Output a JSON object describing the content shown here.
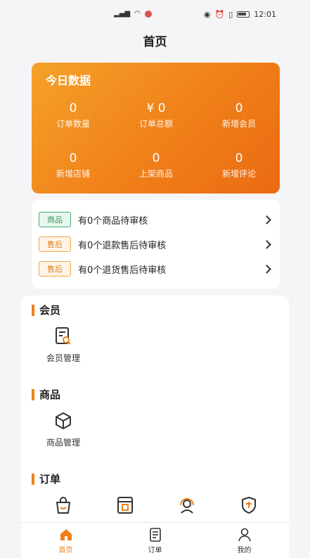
{
  "status_bar": {
    "time": "12:01"
  },
  "header": {
    "title": "首页"
  },
  "today": {
    "title": "今日数据",
    "stats": [
      {
        "value": "0",
        "label": "订单数量"
      },
      {
        "value": "¥ 0",
        "label": "订单总额"
      },
      {
        "value": "0",
        "label": "新增会员"
      },
      {
        "value": "0",
        "label": "新增店铺"
      },
      {
        "value": "0",
        "label": "上架商品"
      },
      {
        "value": "0",
        "label": "新增评论"
      }
    ]
  },
  "pending": [
    {
      "tag": "商品",
      "text": "有0个商品待审核",
      "tag_color": "#3eb06f"
    },
    {
      "tag": "售后",
      "text": "有0个退款售后待审核",
      "tag_color": "#f0a64e"
    },
    {
      "tag": "售后",
      "text": "有0个退货售后待审核",
      "tag_color": "#f0a64e"
    }
  ],
  "sections": {
    "member": {
      "title": "会员",
      "items": [
        {
          "label": "会员管理",
          "icon": "member-doc-search-icon"
        }
      ]
    },
    "goods": {
      "title": "商品",
      "items": [
        {
          "label": "商品管理",
          "icon": "cube-box-icon"
        }
      ]
    },
    "order": {
      "title": "订单",
      "items": [
        {
          "icon": "shopping-bag-icon"
        },
        {
          "icon": "order-box-icon"
        },
        {
          "icon": "customer-service-icon"
        },
        {
          "icon": "after-sale-shield-icon"
        }
      ]
    }
  },
  "tabbar": [
    {
      "label": "首页",
      "icon": "home-icon",
      "active": true
    },
    {
      "label": "订单",
      "icon": "order-doc-icon",
      "active": false
    },
    {
      "label": "我的",
      "icon": "user-icon",
      "active": false
    }
  ],
  "colors": {
    "accent": "#f08019",
    "gradient_start": "#f5a12a",
    "gradient_end": "#ea6a12"
  }
}
